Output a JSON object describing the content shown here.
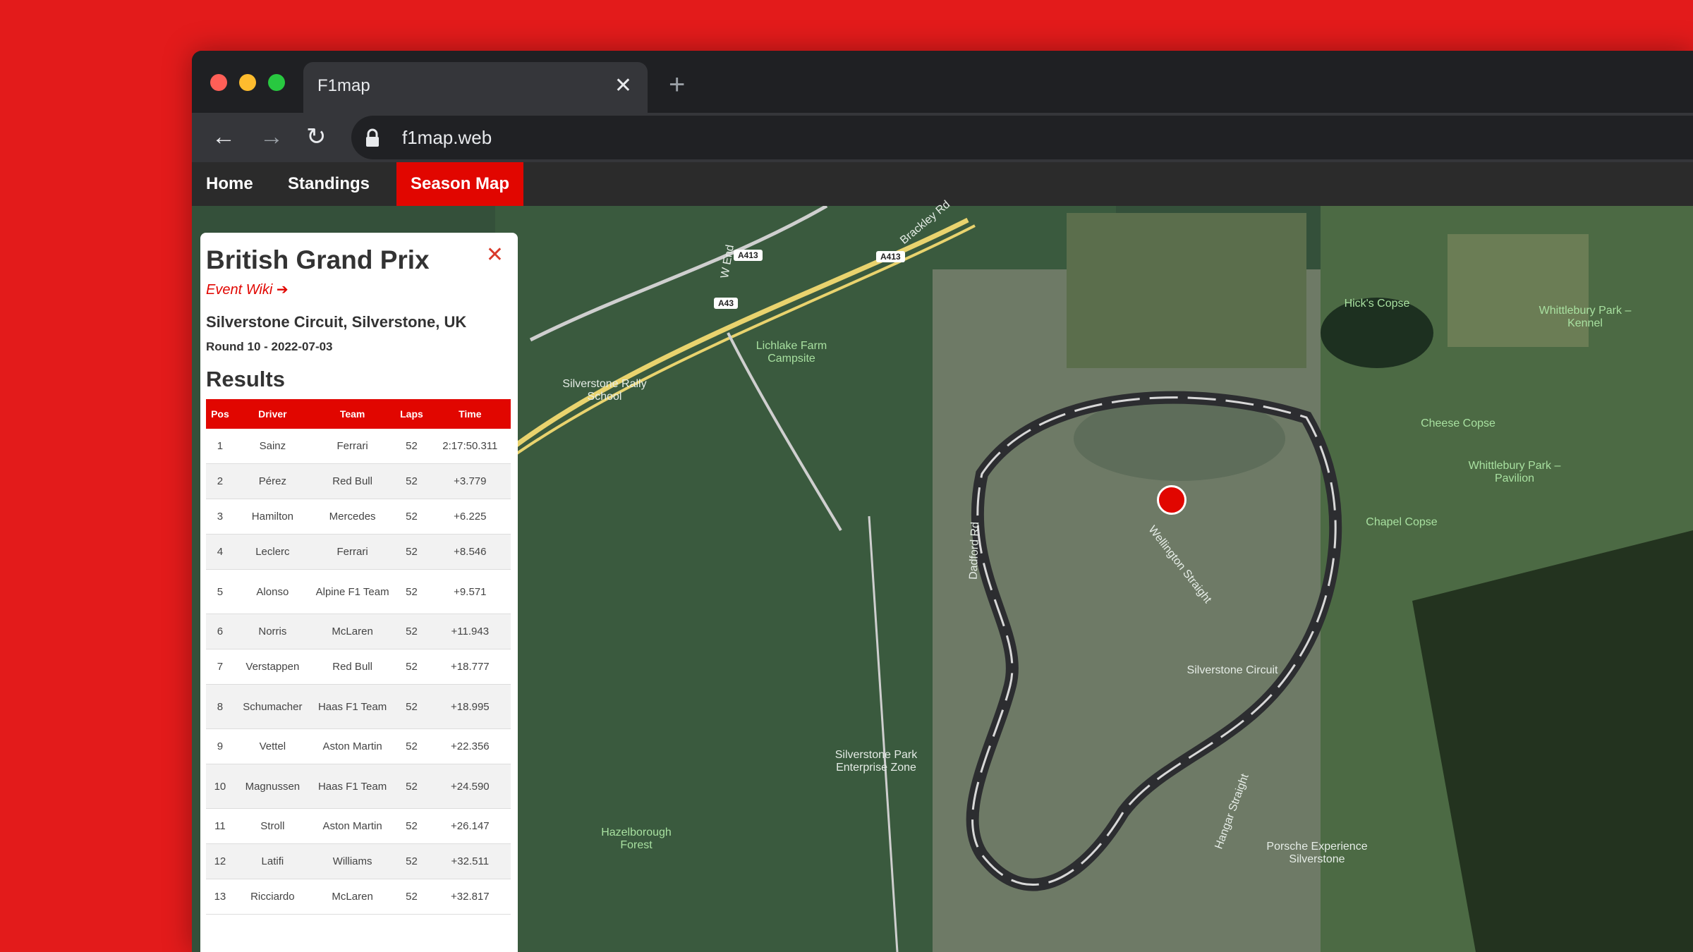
{
  "browser": {
    "tab_title": "F1map",
    "tab_close": "✕",
    "new_tab": "+",
    "url": "f1map.web"
  },
  "nav": {
    "items": [
      {
        "label": "Home",
        "active": false
      },
      {
        "label": "Standings",
        "active": false
      },
      {
        "label": "Season Map",
        "active": true
      }
    ]
  },
  "event": {
    "title": "British Grand Prix",
    "close": "✕",
    "wiki_link": "Event Wiki ➔",
    "venue": "Silverstone Circuit, Silverstone, UK",
    "round_date": "Round 10 - 2022-07-03",
    "results_heading": "Results",
    "columns": [
      "Pos",
      "Driver",
      "Team",
      "Laps",
      "Time"
    ],
    "rows": [
      {
        "pos": "1",
        "driver": "Sainz",
        "team": "Ferrari",
        "laps": "52",
        "time": "2:17:50.311"
      },
      {
        "pos": "2",
        "driver": "Pérez",
        "team": "Red Bull",
        "laps": "52",
        "time": "+3.779"
      },
      {
        "pos": "3",
        "driver": "Hamilton",
        "team": "Mercedes",
        "laps": "52",
        "time": "+6.225"
      },
      {
        "pos": "4",
        "driver": "Leclerc",
        "team": "Ferrari",
        "laps": "52",
        "time": "+8.546"
      },
      {
        "pos": "5",
        "driver": "Alonso",
        "team": "Alpine F1 Team",
        "laps": "52",
        "time": "+9.571"
      },
      {
        "pos": "6",
        "driver": "Norris",
        "team": "McLaren",
        "laps": "52",
        "time": "+11.943"
      },
      {
        "pos": "7",
        "driver": "Verstappen",
        "team": "Red Bull",
        "laps": "52",
        "time": "+18.777"
      },
      {
        "pos": "8",
        "driver": "Schumacher",
        "team": "Haas F1 Team",
        "laps": "52",
        "time": "+18.995"
      },
      {
        "pos": "9",
        "driver": "Vettel",
        "team": "Aston Martin",
        "laps": "52",
        "time": "+22.356"
      },
      {
        "pos": "10",
        "driver": "Magnussen",
        "team": "Haas F1 Team",
        "laps": "52",
        "time": "+24.590"
      },
      {
        "pos": "11",
        "driver": "Stroll",
        "team": "Aston Martin",
        "laps": "52",
        "time": "+26.147"
      },
      {
        "pos": "12",
        "driver": "Latifi",
        "team": "Williams",
        "laps": "52",
        "time": "+32.511"
      },
      {
        "pos": "13",
        "driver": "Ricciardo",
        "team": "McLaren",
        "laps": "52",
        "time": "+32.817"
      }
    ]
  },
  "map": {
    "labels": {
      "silverstone_circuit": "Silverstone Circuit",
      "lichlake_farm_campsite": "Lichlake Farm Campsite",
      "silverstone_rally_school": "Silverstone Rally School",
      "silverstone_park": "Silverstone Park Enterprise Zone",
      "hazelborough_forest": "Hazelborough Forest",
      "hicks_copse": "Hick's Copse",
      "cheese_copse": "Cheese Copse",
      "chapel_copse": "Chapel Copse",
      "whittlebury_park_pavilion": "Whittlebury Park – Pavilion",
      "whittlebury_park_kennel": "Whittlebury Park – Kennel",
      "porsche_experience": "Porsche Experience Silverstone",
      "wellington_straight": "Wellington Straight",
      "hangar_straight": "Hangar Straight",
      "dadford_rd": "Dadford Rd",
      "brackley_rd": "Brackley Rd",
      "w_end": "W End",
      "a413": "A413",
      "a43": "A43"
    }
  },
  "colors": {
    "accent": "#e10600",
    "background": "#e31b1b"
  }
}
